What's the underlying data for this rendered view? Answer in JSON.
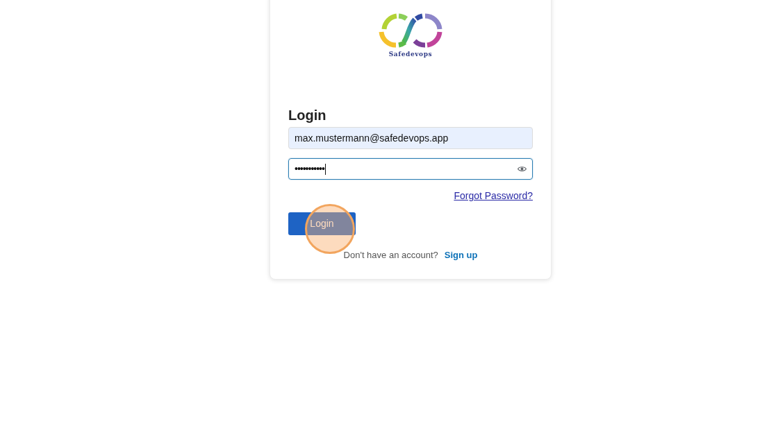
{
  "logo": {
    "text": "Safedevops"
  },
  "heading": "Login",
  "email_field": {
    "value": "max.mustermann@safedevops.app",
    "autofilled": true
  },
  "password_field": {
    "value": "•••••••••••",
    "focused": true
  },
  "forgot_password_link": "Forgot Password?",
  "login_button": {
    "label": "Login",
    "click_highlight": true
  },
  "signup_prompt": {
    "text": "Don't have an account?",
    "link": "Sign up"
  }
}
